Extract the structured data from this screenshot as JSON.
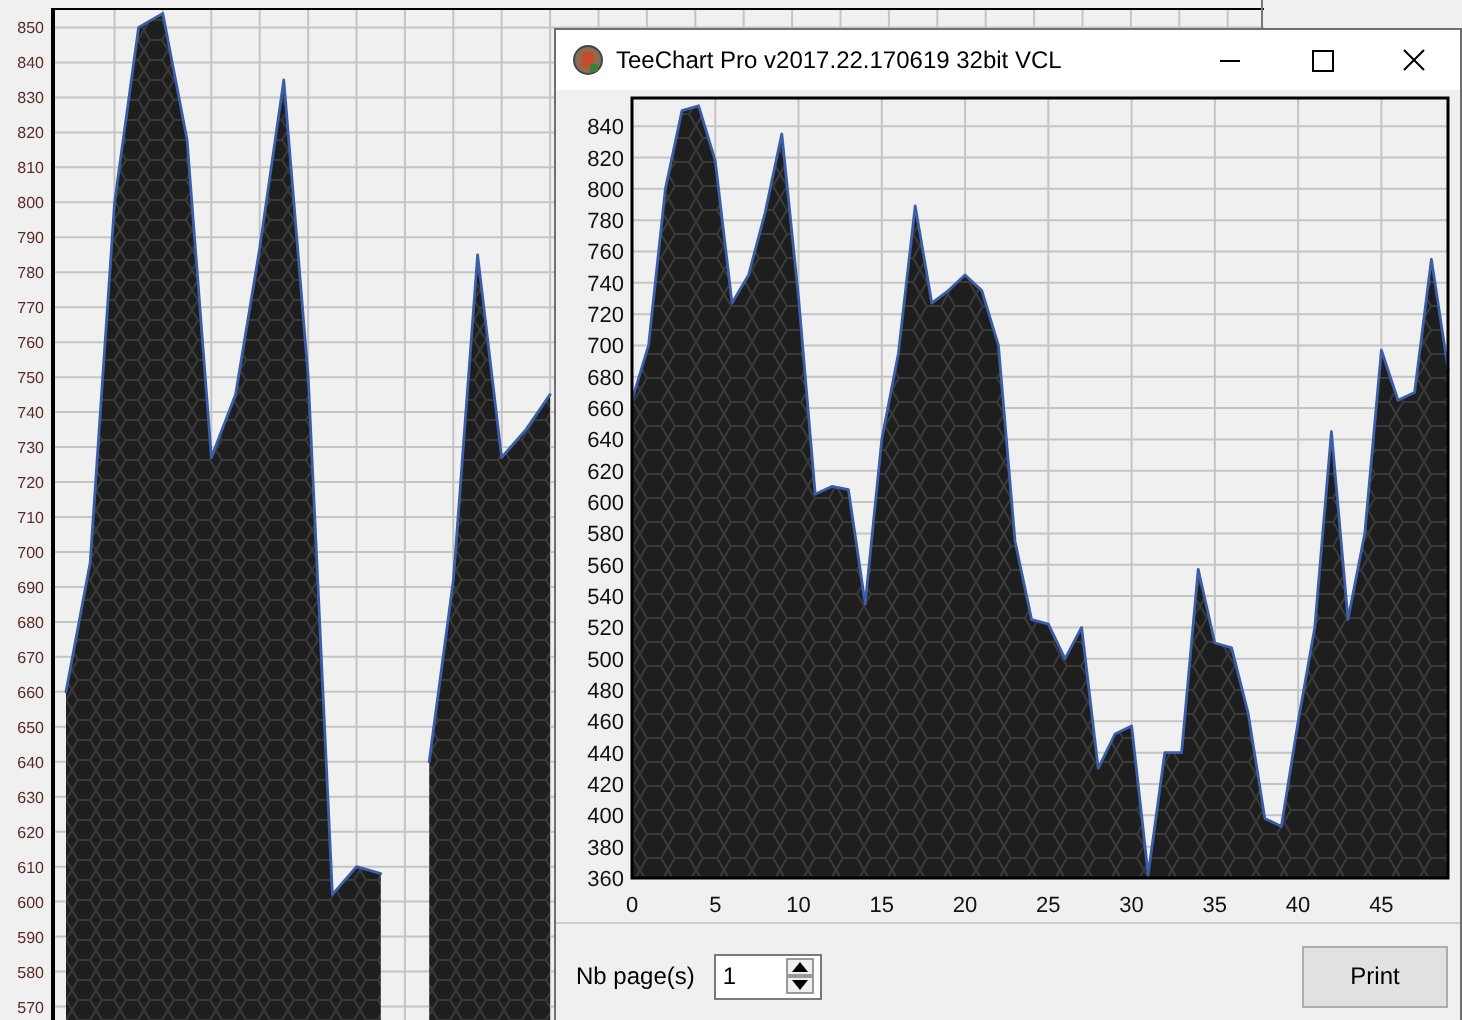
{
  "background_chart": {
    "chart_data": {
      "type": "area",
      "grid": true,
      "categories": [
        null,
        null,
        null,
        null,
        null,
        null,
        null,
        null,
        null,
        null,
        null,
        null,
        null,
        null,
        null,
        null,
        null,
        null,
        null,
        null,
        null,
        null,
        null,
        null,
        null,
        null,
        null,
        null,
        null,
        null,
        null,
        null,
        null,
        null,
        null,
        null,
        null,
        null,
        null,
        null,
        null,
        null,
        null,
        null,
        null,
        null,
        null,
        null,
        null,
        null
      ],
      "ylim": [
        565,
        855
      ],
      "yticks": [
        570,
        580,
        590,
        600,
        610,
        620,
        630,
        640,
        650,
        660,
        670,
        680,
        690,
        700,
        710,
        720,
        730,
        740,
        750,
        760,
        770,
        780,
        790,
        800,
        810,
        820,
        830,
        840,
        850
      ],
      "series": [
        {
          "color": "#3b5ea8",
          "values": [
            660,
            697,
            800,
            850,
            854,
            818,
            727,
            745,
            787,
            835,
            750,
            602,
            610,
            608,
            null,
            640,
            692,
            785,
            727,
            735,
            745,
            null,
            null,
            null,
            null,
            null,
            null,
            null,
            null,
            null,
            null,
            null,
            null,
            null,
            null,
            null,
            null,
            null,
            null,
            null,
            null,
            null,
            null,
            null,
            null,
            null,
            null,
            null,
            null,
            null
          ]
        }
      ]
    }
  },
  "dialog": {
    "title": "TeeChart Pro v2017.22.170619 32bit VCL",
    "chart": {
      "chart_data": {
        "type": "area",
        "grid": true,
        "x": [
          0,
          1,
          2,
          3,
          4,
          5,
          6,
          7,
          8,
          9,
          10,
          11,
          12,
          13,
          14,
          15,
          16,
          17,
          18,
          19,
          20,
          21,
          22,
          23,
          24,
          25,
          26,
          27,
          28,
          29,
          30,
          31,
          32,
          33,
          34,
          35,
          36,
          37,
          38,
          39,
          40,
          41,
          42,
          43,
          44,
          45,
          46,
          47,
          48,
          49
        ],
        "xlim": [
          0,
          49
        ],
        "ylim": [
          360,
          858
        ],
        "xticks": [
          0,
          5,
          10,
          15,
          20,
          25,
          30,
          35,
          40,
          45
        ],
        "yticks": [
          360,
          380,
          400,
          420,
          440,
          460,
          480,
          500,
          520,
          540,
          560,
          580,
          600,
          620,
          640,
          660,
          680,
          700,
          720,
          740,
          760,
          780,
          800,
          820,
          840
        ],
        "series": [
          {
            "color": "#3b5ea8",
            "values": [
              665,
              700,
              800,
              850,
              853,
              818,
              727,
              745,
              785,
              835,
              730,
              605,
              610,
              608,
              535,
              640,
              695,
              789,
              727,
              735,
              745,
              735,
              700,
              575,
              525,
              522,
              500,
              520,
              430,
              452,
              457,
              362,
              440,
              440,
              557,
              510,
              507,
              465,
              398,
              393,
              460,
              520,
              645,
              525,
              580,
              697,
              665,
              670,
              755,
              685
            ]
          }
        ]
      }
    },
    "pages_label": "Nb page(s)",
    "pages_value": "1",
    "print_button": "Print"
  }
}
